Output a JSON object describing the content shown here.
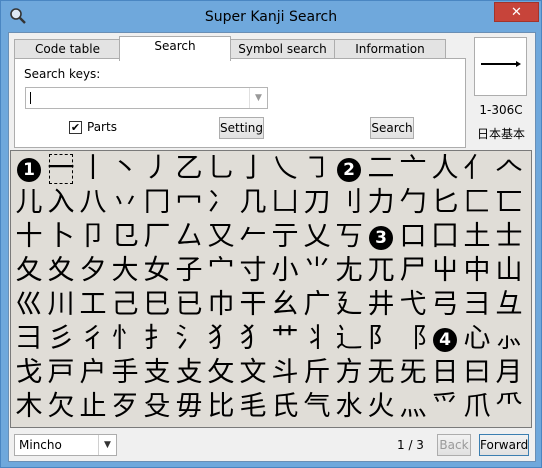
{
  "window": {
    "title": "Super Kanji Search",
    "close_glyph": "✕"
  },
  "tabs": [
    {
      "label": "Code table"
    },
    {
      "label": "Search"
    },
    {
      "label": "Symbol search"
    },
    {
      "label": "Information"
    }
  ],
  "search": {
    "keys_label": "Search keys:",
    "keys_value": "",
    "parts_label": "Parts",
    "parts_checked": true,
    "setting_label": "Setting",
    "search_label": "Search"
  },
  "preview": {
    "glyph": "一",
    "code": "1-306C",
    "classification": "日本基本"
  },
  "grid": {
    "rows": [
      [
        "1",
        "一",
        "丨",
        "丶",
        "丿",
        "乙",
        "乚",
        "亅",
        "乀",
        "㇆",
        "2",
        "二",
        "亠",
        "人",
        "亻",
        "𠆢"
      ],
      [
        "儿",
        "入",
        "八",
        "丷",
        "冂",
        "冖",
        "冫",
        "几",
        "凵",
        "刀",
        "刂",
        "力",
        "勹",
        "匕",
        "匚",
        "匸"
      ],
      [
        "十",
        "卜",
        "卩",
        "㔾",
        "厂",
        "厶",
        "又",
        "𠂉",
        "亍",
        "乂",
        "丂",
        "3",
        "口",
        "囗",
        "土",
        "士"
      ],
      [
        "夂",
        "夊",
        "夕",
        "大",
        "女",
        "子",
        "宀",
        "寸",
        "小",
        "⺌",
        "尢",
        "兀",
        "尸",
        "屮",
        "中",
        "山"
      ],
      [
        "巛",
        "川",
        "工",
        "己",
        "巳",
        "已",
        "巾",
        "干",
        "幺",
        "广",
        "廴",
        "井",
        "弋",
        "弓",
        "彐",
        "彑"
      ],
      [
        "彐",
        "彡",
        "彳",
        "忄",
        "扌",
        "氵",
        "犭",
        "⺨",
        "艹",
        "丬",
        "辶",
        "阝",
        "⻏",
        "4",
        "心",
        "⺗"
      ],
      [
        "戈",
        "戸",
        "户",
        "手",
        "支",
        "攴",
        "攵",
        "文",
        "斗",
        "斤",
        "方",
        "无",
        "旡",
        "日",
        "曰",
        "月"
      ],
      [
        "木",
        "欠",
        "止",
        "歹",
        "殳",
        "毋",
        "比",
        "毛",
        "氏",
        "气",
        "水",
        "火",
        "灬",
        "爫",
        "爪",
        "⺥"
      ]
    ]
  },
  "footer": {
    "font_value": "Mincho",
    "page": "1 / 3",
    "back_label": "Back",
    "forward_label": "Forward"
  }
}
